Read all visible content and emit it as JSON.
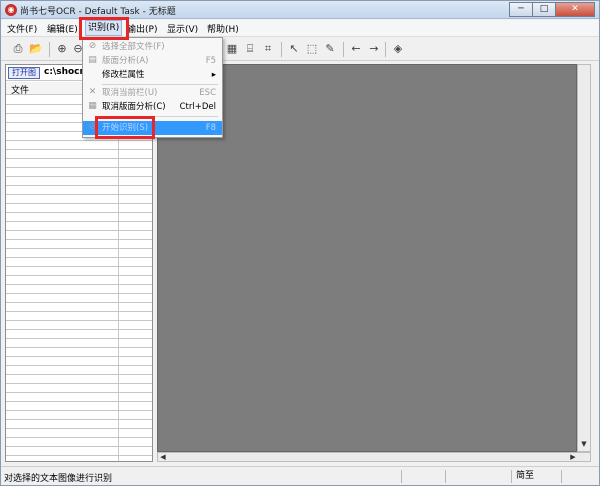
{
  "window": {
    "title": "尚书七号OCR - Default Task - 无标题",
    "buttons": {
      "minimize": "─",
      "maximize": "□",
      "close": "✕"
    }
  },
  "menubar": {
    "items": [
      {
        "label": "文件(F)"
      },
      {
        "label": "编辑(E)"
      },
      {
        "label": "识别(R)"
      },
      {
        "label": "输出(P)"
      },
      {
        "label": "显示(V)"
      },
      {
        "label": "帮助(H)"
      }
    ]
  },
  "dropdown": {
    "items": [
      {
        "icon": "select-all-icon",
        "glyph": "⊘",
        "label": "选择全部文件(F)",
        "key": "",
        "state": "disabled"
      },
      {
        "icon": "layout-analysis-icon",
        "glyph": "▤",
        "label": "版面分析(A)",
        "key": "F5",
        "state": "disabled"
      },
      {
        "icon": "",
        "glyph": "",
        "label": "修改栏属性",
        "key": "▸",
        "state": "enabled"
      },
      {
        "icon": "cancel-current-icon",
        "glyph": "✕",
        "label": "取消当前栏(U)",
        "key": "ESC",
        "state": "disabled"
      },
      {
        "icon": "cancel-layout-icon",
        "glyph": "▦",
        "label": "取消版面分析(C)",
        "key": "Ctrl+Del",
        "state": "enabled"
      },
      {
        "icon": "start-recognize-icon",
        "glyph": "⊘",
        "label": "开始识别(S)",
        "key": "F8",
        "state": "selected"
      }
    ]
  },
  "left_panel": {
    "open_button": "打开图",
    "path": "c:\\shocr",
    "column_header": "文件"
  },
  "statusbar": {
    "text": "对选择的文本图像进行识别",
    "cells": [
      "",
      "",
      "简至",
      ""
    ]
  },
  "colors": {
    "highlight_border": "#e8262a",
    "menu_selected": "#3399ff",
    "canvas": "#7d7d7d"
  }
}
